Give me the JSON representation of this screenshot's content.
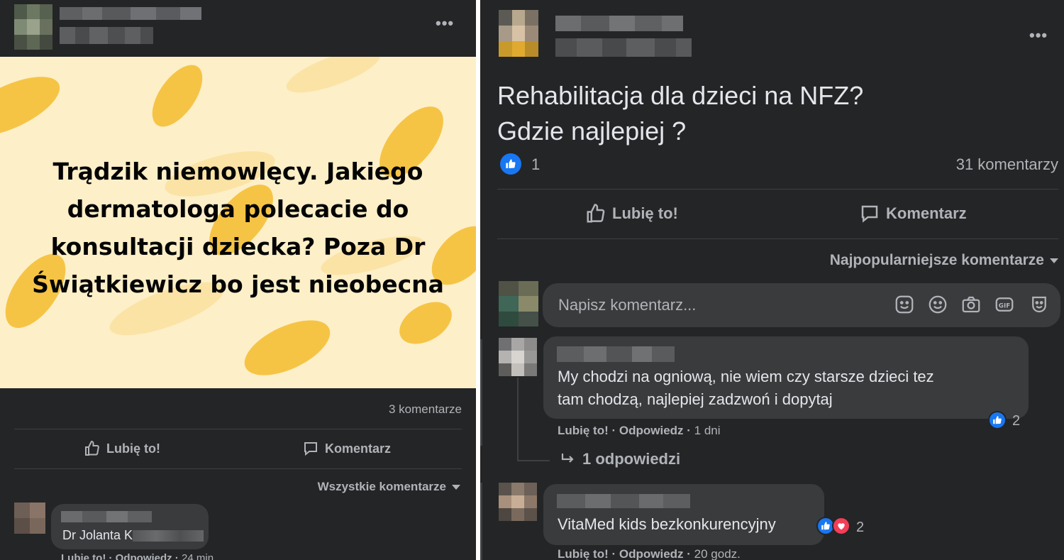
{
  "left_post": {
    "banner_text": "Trądzik niemowlęcy. Jakiego dermatologa polecacie do konsultacji dziecka? Poza Dr Świątkiewicz bo jest nieobecna",
    "comments_count": "3 komentarze",
    "like_label": "Lubię to!",
    "comment_label": "Komentarz",
    "sort_label": "Wszystkie komentarze",
    "comment1_text": "Dr Jolanta K",
    "comment1_like": "Lubię to!",
    "comment1_reply": "Odpowiedz",
    "comment1_time": "24 min"
  },
  "right_post": {
    "question_line1": "Rehabilitacja dla dzieci na NFZ?",
    "question_line2": "Gdzie najlepiej ?",
    "reaction_count": "1",
    "comments_count": "31 komentarzy",
    "like_label": "Lubię to!",
    "comment_label": "Komentarz",
    "sort_label": "Najpopularniejsze komentarze",
    "input_placeholder": "Napisz komentarz...",
    "comment1_line1": "My chodzi na ogniową, nie wiem czy starsze dzieci tez",
    "comment1_line2": "tam chodzą, najlepiej zadzwoń i dopytaj",
    "comment1_reactions": "2",
    "comment1_like": "Lubię to!",
    "comment1_reply": "Odpowiedz",
    "comment1_time": "1 dni",
    "replies_link": "1 odpowiedzi",
    "comment2_text": "VitaMed kids bezkonkurencyjny",
    "comment2_reactions": "2",
    "comment2_like": "Lubię to!",
    "comment2_reply": "Odpowiedz",
    "comment2_time": "20 godz."
  },
  "colors": {
    "card_bg": "#242526",
    "bubble_bg": "#3a3b3c",
    "banner_bg": "#fdefc8",
    "banner_blob": "#f6c445",
    "like_blue": "#1877f2",
    "love_red": "#f33e58"
  },
  "icons": [
    "more-icon",
    "thumbs-up-icon",
    "comment-icon",
    "chevron-down-icon",
    "sticker-icon",
    "emoji-icon",
    "camera-icon",
    "gif-icon",
    "avatar-sticker-icon",
    "reply-arrow-icon",
    "heart-icon"
  ]
}
